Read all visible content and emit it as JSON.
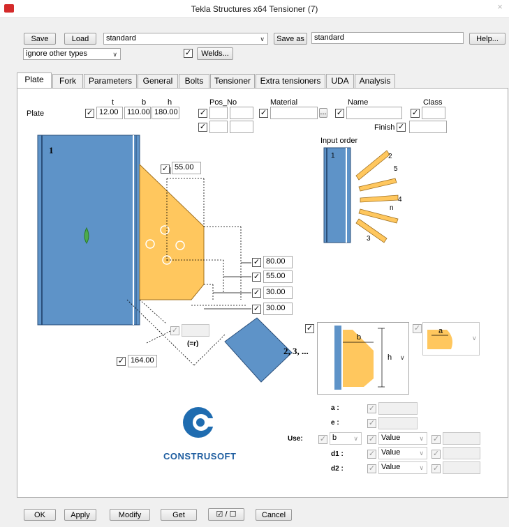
{
  "window": {
    "title": "Tekla Structures x64  Tensioner (7)",
    "close": "×"
  },
  "toolbar": {
    "save": "Save",
    "load": "Load",
    "preset": "standard",
    "save_as": "Save as",
    "save_as_name": "standard",
    "help": "Help..."
  },
  "filter": {
    "value": "ignore other types",
    "welds_label": "Welds..."
  },
  "tabs": [
    "Plate",
    "Fork",
    "Parameters",
    "General",
    "Bolts",
    "Tensioner",
    "Extra tensioners",
    "UDA",
    "Analysis"
  ],
  "plate_row": {
    "row_label": "Plate",
    "t_header": "t",
    "b_header": "b",
    "h_header": "h",
    "t": "12.00",
    "b": "110.00",
    "h": "180.00",
    "pos_no_header": "Pos_No",
    "material_header": "Material",
    "name_header": "Name",
    "class_header": "Class",
    "finish_label": "Finish",
    "browse": "..."
  },
  "drawing": {
    "plate_number": "1",
    "dim_top": "55.00",
    "dim_80": "80.00",
    "dim_55": "55.00",
    "dim_30a": "30.00",
    "dim_30b": "30.00",
    "dim_diag": "164.00",
    "eq_r": "(=r)",
    "label_23": "2, 3, ..."
  },
  "input_order": {
    "title": "Input order",
    "n1": "1",
    "n2": "2",
    "n5": "5",
    "n4": "4",
    "nn": "n",
    "n3": "3"
  },
  "preview": {
    "b": "b",
    "h": "h",
    "a": "a"
  },
  "params": {
    "a_label": "a :",
    "e_label": "e :",
    "use_label": "Use:",
    "use_value": "b",
    "d1_label": "d1 :",
    "d2_label": "d2 :",
    "value_opt": "Value"
  },
  "logo": {
    "text": "CONSTRUSOFT"
  },
  "bottom": {
    "ok": "OK",
    "apply": "Apply",
    "modify": "Modify",
    "get": "Get",
    "toggle": "☑ / ☐",
    "cancel": "Cancel"
  },
  "colors": {
    "column_blue": "#5e93c8",
    "plate_yellow": "#ffc75e",
    "brand_blue": "#1f6cb0"
  }
}
